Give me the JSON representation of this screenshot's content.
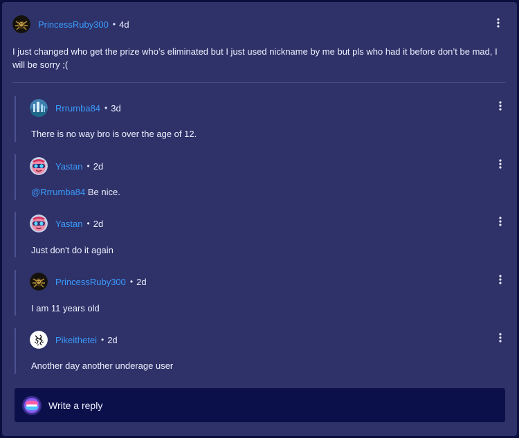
{
  "post": {
    "username": "PrincessRuby300",
    "separator": "•",
    "age": "4d",
    "body": "I just changed who get the prize who’s eliminated but I just used nickname by me but pls who had it before don’t be mad, I will be sorry ;(",
    "avatar_icon": "ruby-spider-avatar-icon",
    "menu_icon": "more-vertical-icon"
  },
  "replies": [
    {
      "username": "Rrrumba84",
      "separator": "•",
      "age": "3d",
      "mention": "",
      "body": "There is no way bro is over the age of 12.",
      "avatar_icon": "city-avatar-icon"
    },
    {
      "username": "Yastan",
      "separator": "•",
      "age": "2d",
      "mention": "@Rrrumba84",
      "body": " Be nice.",
      "avatar_icon": "pink-goggles-avatar-icon"
    },
    {
      "username": "Yastan",
      "separator": "•",
      "age": "2d",
      "mention": "",
      "body": "Just don't do it again",
      "avatar_icon": "pink-goggles-avatar-icon"
    },
    {
      "username": "PrincessRuby300",
      "separator": "•",
      "age": "2d",
      "mention": "",
      "body": "I am 11 years old",
      "avatar_icon": "ruby-spider-avatar-icon"
    },
    {
      "username": "Pikeithetei",
      "separator": "•",
      "age": "2d",
      "mention": "",
      "body": "Another day another underage user",
      "avatar_icon": "sketch-avatar-icon"
    }
  ],
  "reply_box": {
    "placeholder": "Write a reply",
    "avatar_icon": "user-gem-avatar-icon"
  },
  "colors": {
    "page_bg": "#0b0f3f",
    "panel_bg": "#2e3268",
    "username": "#3b9bff",
    "text": "#eef0ff",
    "reply_box_bg": "#0b0f4a",
    "rail": "#4d5290"
  }
}
